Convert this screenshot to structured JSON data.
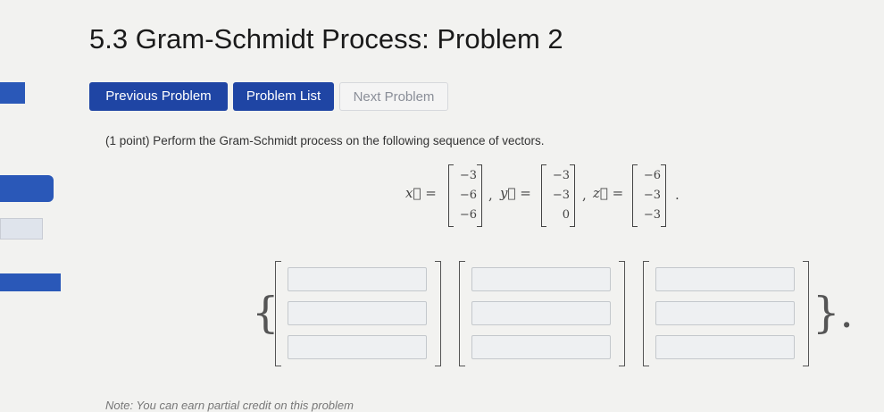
{
  "page": {
    "title": "5.3 Gram-Schmidt Process: Problem 2"
  },
  "nav": {
    "previous": "Previous Problem",
    "list": "Problem List",
    "next": "Next Problem"
  },
  "problem": {
    "text": "(1 point) Perform the Gram-Schmidt process on the following sequence of vectors.",
    "vectors": [
      {
        "label": "x⃗ =",
        "entries": [
          "−3",
          "−6",
          "−6"
        ],
        "sep": ","
      },
      {
        "label": "y⃗ =",
        "entries": [
          "−3",
          "−3",
          "0"
        ],
        "sep": ","
      },
      {
        "label": "z⃗ =",
        "entries": [
          "−6",
          "−3",
          "−3"
        ],
        "sep": "."
      }
    ]
  },
  "answer": {
    "open_brace": "{",
    "close_brace": "}.",
    "vectors": [
      {
        "entries": [
          "",
          "",
          ""
        ]
      },
      {
        "entries": [
          "",
          "",
          ""
        ]
      },
      {
        "entries": [
          "",
          "",
          ""
        ]
      }
    ]
  },
  "note": "Note: You can earn partial credit on this problem"
}
